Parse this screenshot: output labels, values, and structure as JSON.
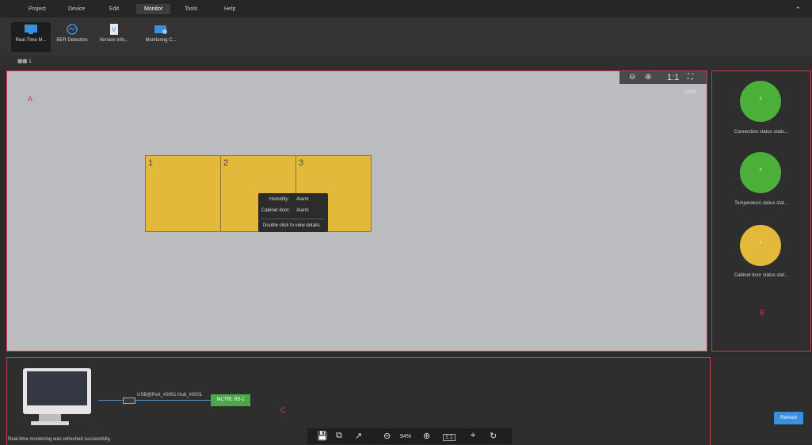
{
  "menu": {
    "items": [
      "Project",
      "Device",
      "Edit",
      "Monitor",
      "Tools",
      "Help"
    ],
    "active": "Monitor"
  },
  "ribbon": {
    "tools": [
      {
        "label": "Real-Time M...",
        "icon": "realtime-monitor-icon"
      },
      {
        "label": "BER Detection",
        "icon": "ber-detection-icon"
      },
      {
        "label": "Version Info...",
        "icon": "version-info-icon"
      },
      {
        "label": "Monitoring C...",
        "icon": "monitoring-config-icon"
      }
    ]
  },
  "screen_tab": {
    "label": "1"
  },
  "canvas": {
    "area_letter": "A",
    "zoom_label": "1:1",
    "zoom_hint": "100%",
    "panels": [
      "1",
      "2",
      "3"
    ],
    "tooltip": {
      "humidity_label": "Humidity:",
      "humidity_value": "Alarm",
      "door_label": "Cabinet door:",
      "door_value": "Alarm",
      "hint": "Double click to view details"
    }
  },
  "status_panel": {
    "area_letter": "B",
    "items": [
      {
        "count": "3",
        "label": "Connection status statis...",
        "color": "#4caf3a"
      },
      {
        "count": "3",
        "label": "Temperature status stat...",
        "color": "#4caf3a"
      },
      {
        "count": "3",
        "label": "Cabinet door status stat...",
        "color": "#e3b93b"
      }
    ]
  },
  "topology": {
    "area_letter": "C",
    "port_label": "USB@Port_#0001.Hub_#0001",
    "device_label": "MCTRL R5-1"
  },
  "refresh_label": "Refresh",
  "status_text": "Real-time monitoring was refreshed successfully.",
  "bottom_toolbar": {
    "zoom_percent": "94%",
    "one_to_one": "1:1"
  }
}
